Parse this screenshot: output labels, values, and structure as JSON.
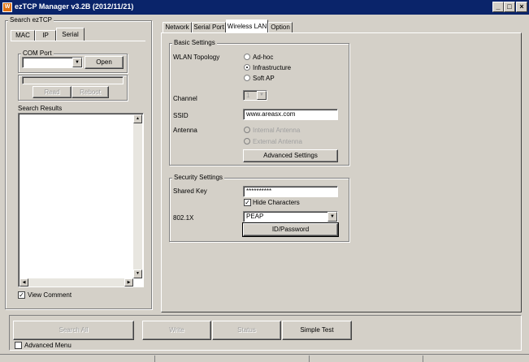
{
  "window": {
    "app_icon": "W",
    "title": "ezTCP Manager v3.2B (2012/11/21)",
    "min_label": "_",
    "max_label": "□",
    "close_label": "×"
  },
  "search": {
    "group_label": "Search ezTCP",
    "tabs": [
      "MAC",
      "IP",
      "Serial"
    ],
    "com_port_label": "COM Port",
    "com_port_value": "",
    "open_label": "Open",
    "read_label": "Read",
    "reboot_label": "Reboot",
    "results_label": "Search Results",
    "view_comment_label": "View Comment",
    "view_comment_checked": true
  },
  "tabs": [
    "Network",
    "Serial Port",
    "Wireless LAN",
    "Option"
  ],
  "basic": {
    "group_label": "Basic Settings",
    "topology_label": "WLAN Topology",
    "topology_options": [
      "Ad-hoc",
      "Infrastructure",
      "Soft AP"
    ],
    "topology_selected": "Infrastructure",
    "channel_label": "Channel",
    "channel_value": "1",
    "ssid_label": "SSID",
    "ssid_value": "www.areasx.com",
    "antenna_label": "Antenna",
    "antenna_options": [
      "Internal Antenna",
      "External Antenna"
    ],
    "advanced_label": "Advanced Settings"
  },
  "security": {
    "group_label": "Security Settings",
    "shared_key_label": "Shared Key",
    "shared_key_value": "**********",
    "hide_chars_label": "Hide Characters",
    "hide_chars_checked": true,
    "auth_label": "802.1X",
    "auth_value": "PEAP",
    "idpw_label": "ID/Password"
  },
  "bottom": {
    "search_all_label": "Search All",
    "write_label": "Write",
    "status_label": "Status",
    "simple_test_label": "Simple Test",
    "advanced_menu_label": "Advanced Menu",
    "advanced_menu_checked": false
  },
  "icons": {
    "dropdown_arrow": "▼",
    "check_mark": "✓",
    "scroll_up": "▲",
    "scroll_down": "▼",
    "scroll_left": "◀",
    "scroll_right": "▶"
  }
}
